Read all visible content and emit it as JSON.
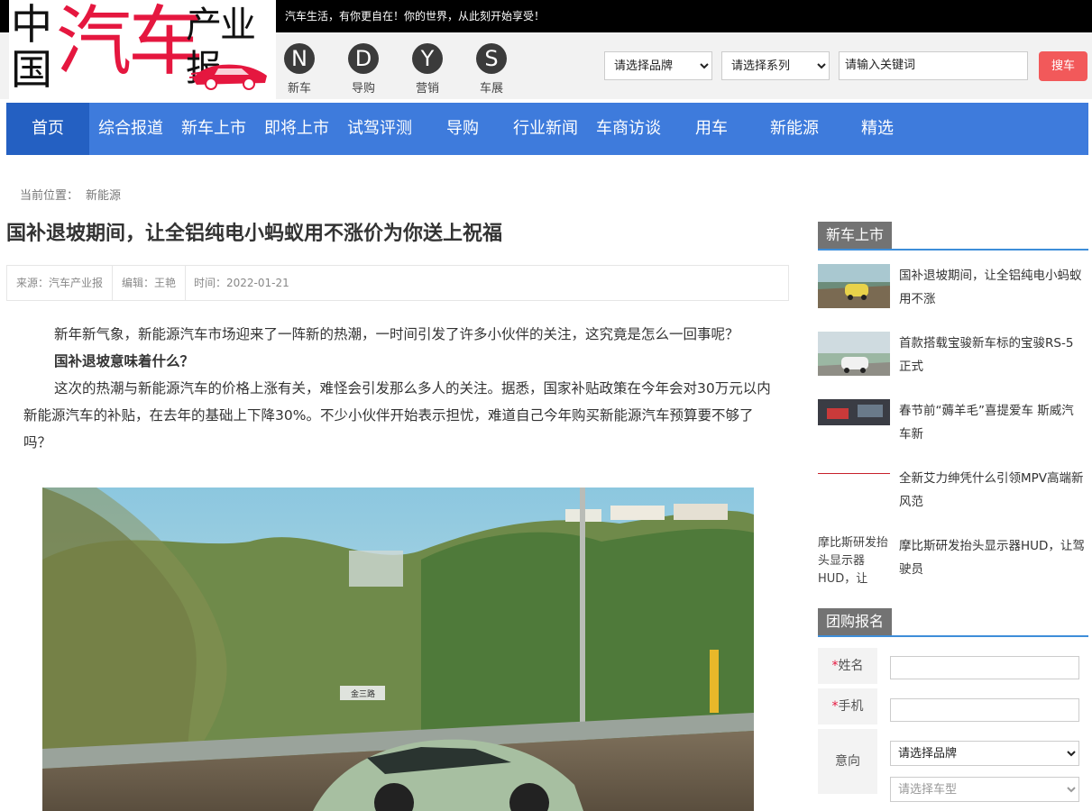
{
  "topbar": {
    "slogan": "汽车生活，有你更自在！你的世界，从此刻开始享受！"
  },
  "logo": {
    "zhong": "中",
    "guo": "国",
    "qiche": "汽车",
    "chanyebao": "产业报"
  },
  "quicknav": [
    {
      "letter": "N",
      "label": "新车"
    },
    {
      "letter": "D",
      "label": "导购"
    },
    {
      "letter": "Y",
      "label": "营销"
    },
    {
      "letter": "S",
      "label": "车展"
    }
  ],
  "search": {
    "brand_select": "请选择品牌",
    "series_select": "请选择系列",
    "keyword": "请输入关键词",
    "button": "搜车"
  },
  "mainnav": [
    "首页",
    "综合报道",
    "新车上市",
    "即将上市",
    "试驾评测",
    "导购",
    "行业新闻",
    "车商访谈",
    "用车",
    "新能源",
    "精选"
  ],
  "breadcrumb": {
    "label": "当前位置：",
    "current": "新能源"
  },
  "article": {
    "title": "国补退坡期间，让全铝纯电小蚂蚁用不涨价为你送上祝福",
    "source": "来源：汽车产业报",
    "editor": "编辑：王艳",
    "time": "时间：2022-01-21",
    "para1": "新年新气象，新能源汽车市场迎来了一阵新的热潮，一时间引发了许多小伙伴的关注，这究竟是怎么一回事呢？",
    "subtitle": "国补退坡意味着什么？",
    "para2": "这次的热潮与新能源汽车的价格上涨有关，难怪会引发那么多人的关注。据悉，国家补贴政策在今年会对30万元以内新能源汽车的补贴，在去年的基础上下降30%。不少小伙伴开始表示担忧，难道自己今年购买新能源汽车预算要不够了吗？",
    "sign_text": "金三路"
  },
  "sidebar": {
    "new_cars_title": "新车上市",
    "news": [
      "国补退坡期间，让全铝纯电小蚂蚁用不涨",
      "首款搭载宝骏新车标的宝骏RS-5正式",
      "春节前“薅羊毛”喜提爱车 斯威汽车新",
      "全新艾力绅凭什么引领MPV高端新风范",
      "摩比斯研发抬头显示器HUD，让驾驶员"
    ],
    "broken_img_alt": "摩比斯研发抬头显示器HUD，让",
    "group_title": "团购报名",
    "form": {
      "name_label": "姓名",
      "phone_label": "手机",
      "intent_label": "意向",
      "required_mark": "*",
      "brand_select": "请选择品牌",
      "model_select": "请选择车型"
    }
  }
}
